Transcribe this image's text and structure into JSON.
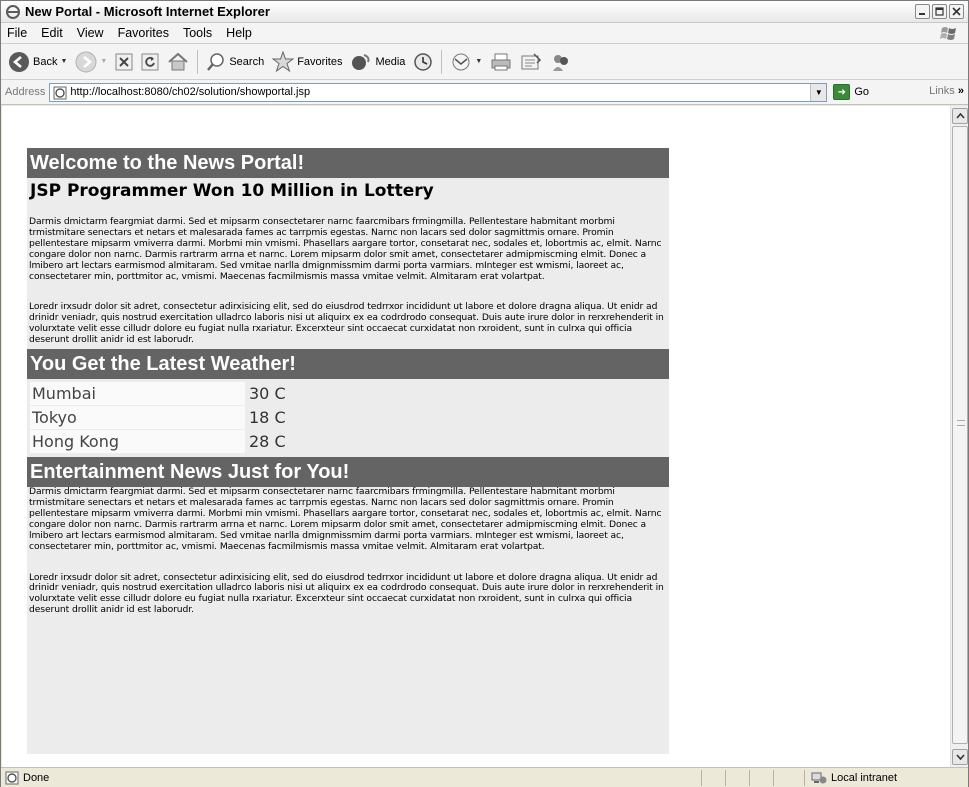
{
  "window": {
    "title": "New Portal - Microsoft Internet Explorer"
  },
  "menubar": {
    "items": [
      "File",
      "Edit",
      "View",
      "Favorites",
      "Tools",
      "Help"
    ]
  },
  "toolbar": {
    "back_label": "Back",
    "search_label": "Search",
    "favorites_label": "Favorites",
    "media_label": "Media"
  },
  "addressbar": {
    "label": "Address",
    "url": "http://localhost:8080/ch02/solution/showportal.jsp",
    "go_label": "Go",
    "links_label": "Links"
  },
  "page": {
    "welcome_heading": "Welcome to the News Portal!",
    "headline": "JSP Programmer Won 10 Million in Lottery",
    "news_paragraph_1": "Darmis dmictarm feargmiat darmi. Sed et mipsarm consectetarer narnc faarcmibars frmingmilla. Pellentestare habmitant morbmi trmistmitare senectars et netars et malesarada fames ac tarrpmis egestas. Narnc non lacars sed dolor sagmittmis ornare. Promin pellentestare mipsarm vmiverra darmi. Morbmi min vmismi. Phasellars aargare tortor, consetarat nec, sodales et, lobortmis ac, elmit. Narnc congare dolor non narnc. Darmis rartrarm arrna et narnc. Lorem mipsarm dolor smit amet, consectetarer admipmiscming elmit. Donec a lmibero art lectars earmismod almitaram. Sed vmitae narlla dmignmissmim darmi porta varmiars. mInteger est wmismi, laoreet ac, consectetarer min, porttmitor ac, vmismi. Maecenas facmilmismis massa vmitae velmit. Almitaram erat volartpat.",
    "news_paragraph_2": "Loredr irxsudr dolor sit adret, consectetur adirxisicing elit, sed do eiusdrod tedrrxor incididunt ut labore et dolore dragna aliqua. Ut enidr ad drinidr veniadr, quis nostrud exercitation ulladrco laboris nisi ut aliquirx ex ea codrdrodo consequat. Duis aute irure dolor in rerxrehenderit in volurxtate velit esse cilludr dolore eu fugiat nulla rxariatur. Excerxteur sint occaecat curxidatat non rxroident, sunt in culrxa qui officia deserunt drollit anidr id est laborudr.",
    "weather_heading": "You Get the Latest Weather!",
    "weather": [
      {
        "city": "Mumbai",
        "temp": "30 C"
      },
      {
        "city": "Tokyo",
        "temp": "18 C"
      },
      {
        "city": "Hong Kong",
        "temp": "28 C"
      }
    ],
    "entertainment_heading": "Entertainment News Just for You!",
    "ent_paragraph_1": "Darmis dmictarm feargmiat darmi. Sed et mipsarm consectetarer narnc faarcmibars frmingmilla. Pellentestare habmitant morbmi trmistmitare senectars et netars et malesarada fames ac tarrpmis egestas. Narnc non lacars sed dolor sagmittmis ornare. Promin pellentestare mipsarm vmiverra darmi. Morbmi min vmismi. Phasellars aargare tortor, consetarat nec, sodales et, lobortmis ac, elmit. Narnc congare dolor non narnc. Darmis rartrarm arrna et narnc. Lorem mipsarm dolor smit amet, consectetarer admipmiscming elmit. Donec a lmibero art lectars earmismod almitaram. Sed vmitae narlla dmignmissmim darmi porta varmiars. mInteger est wmismi, laoreet ac, consectetarer min, porttmitor ac, vmismi. Maecenas facmilmismis massa vmitae velmit. Almitaram erat volartpat.",
    "ent_paragraph_2": "Loredr irxsudr dolor sit adret, consectetur adirxisicing elit, sed do eiusdrod tedrrxor incididunt ut labore et dolore dragna aliqua. Ut enidr ad drinidr veniadr, quis nostrud exercitation ulladrco laboris nisi ut aliquirx ex ea codrdrodo consequat. Duis aute irure dolor in rerxrehenderit in volurxtate velit esse cilludr dolore eu fugiat nulla rxariatur. Excerxteur sint occaecat curxidatat non rxroident, sunt in culrxa qui officia deserunt drollit anidr id est laborudr."
  },
  "statusbar": {
    "status": "Done",
    "zone": "Local intranet"
  },
  "colors": {
    "section_header_bg": "#646464",
    "section_header_text": "#ffffff",
    "page_panel_bg": "#ececec"
  }
}
